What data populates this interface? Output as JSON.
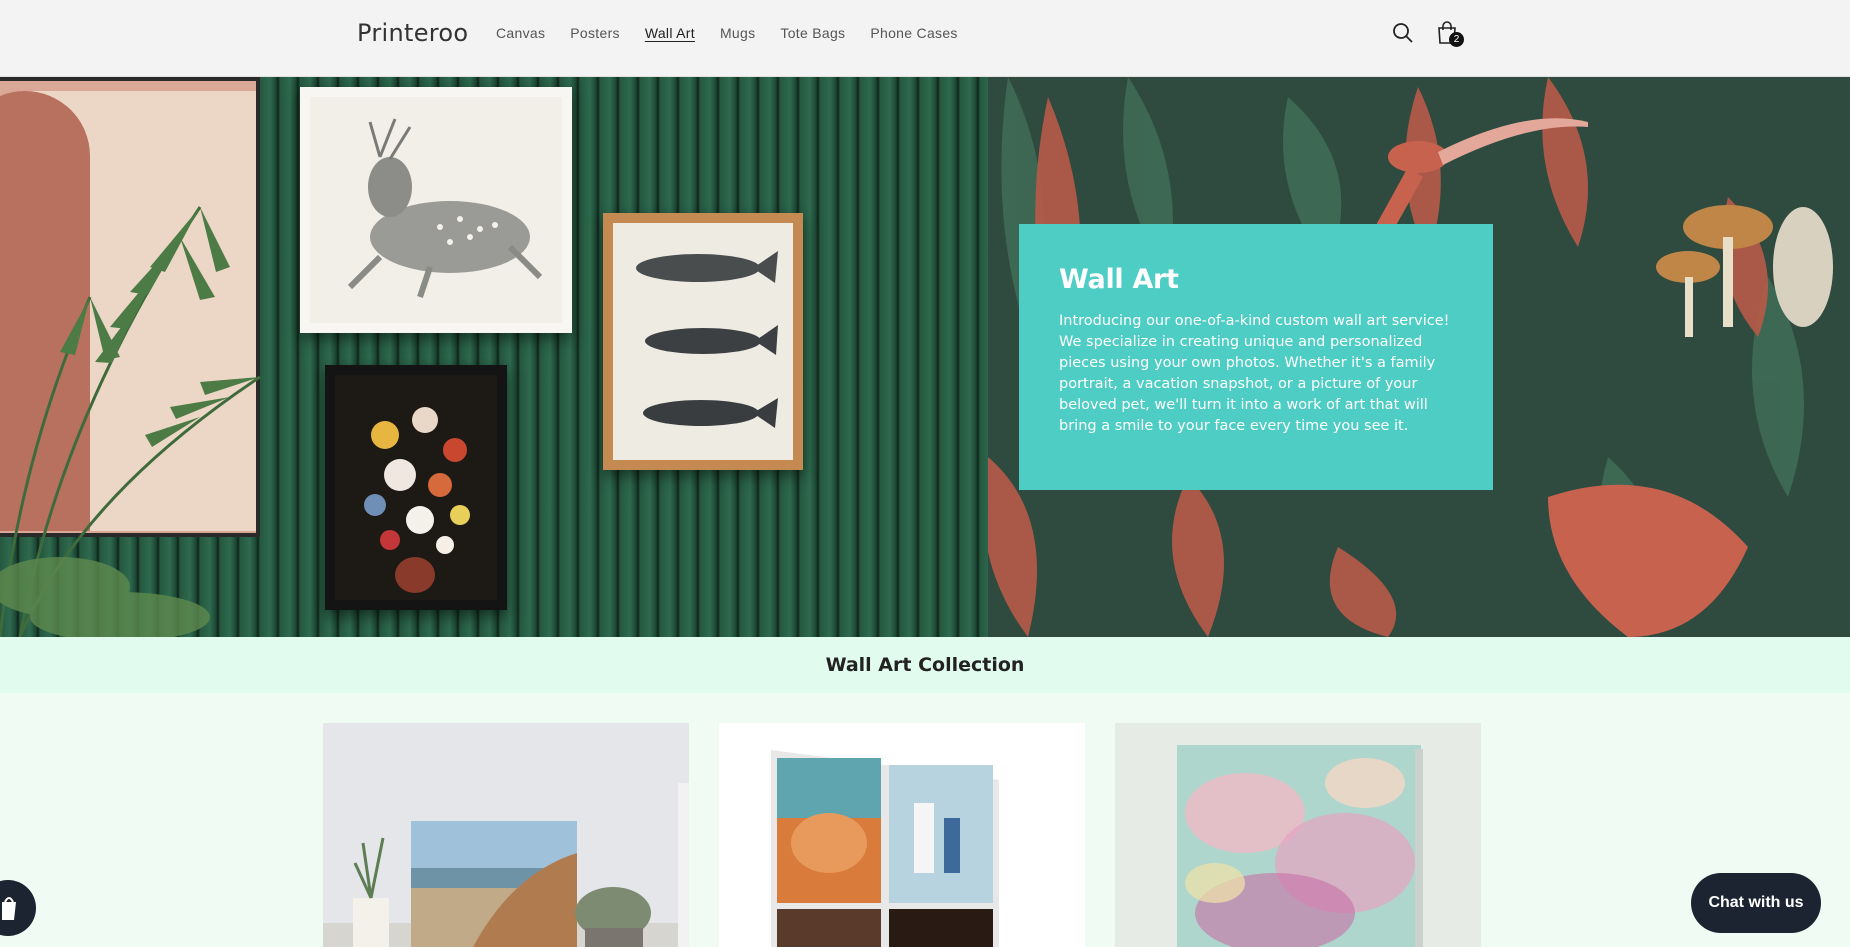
{
  "header": {
    "logo": "Printeroo",
    "nav": [
      "Canvas",
      "Posters",
      "Wall Art",
      "Mugs",
      "Tote Bags",
      "Phone Cases"
    ],
    "active_nav": "Wall Art",
    "cart_count": "2",
    "icons": [
      "search-icon",
      "cart-icon"
    ]
  },
  "hero": {
    "title": "Wall Art",
    "text": "Introducing our one-of-a-kind custom wall art service! We specialize in creating unique and personalized pieces using your own photos. Whether it's a family portrait, a vacation snapshot, or a picture of your beloved pet, we'll turn it into a work of art that will bring a smile to your face every time you see it.",
    "box_color": "#4ecdc4"
  },
  "collection": {
    "title": "Wall Art Collection"
  },
  "chat": {
    "label": "Chat with us"
  },
  "colors": {
    "header_bg": "#f3f3f3",
    "band_bg": "#e1fbef",
    "page_bg": "#f0fbf3",
    "chat_bg": "#1b2430"
  }
}
